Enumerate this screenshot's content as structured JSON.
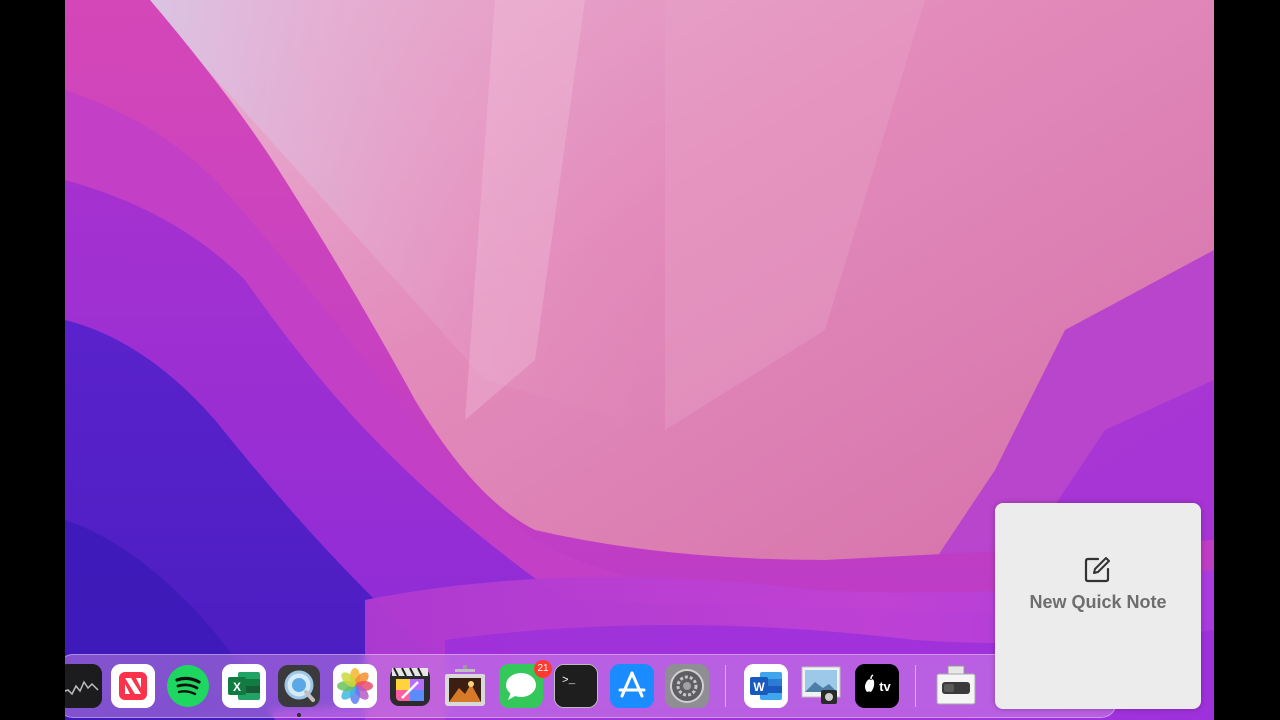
{
  "desktop": {
    "wallpaper": "macOS Monterey wallpaper",
    "accent_colors": [
      "#c955b0",
      "#8a2bd8",
      "#4b1fc4",
      "#e7a0c8"
    ]
  },
  "dock": {
    "apps": [
      {
        "name": "Stocks",
        "icon": "stocks-icon",
        "running": false
      },
      {
        "name": "News",
        "icon": "news-icon",
        "running": false
      },
      {
        "name": "Spotify",
        "icon": "spotify-icon",
        "running": false
      },
      {
        "name": "Microsoft Excel",
        "icon": "excel-icon",
        "running": false
      },
      {
        "name": "QuickTime Player",
        "icon": "quicktime-icon",
        "running": true
      },
      {
        "name": "Photos",
        "icon": "photos-icon",
        "running": false
      },
      {
        "name": "Final Cut Pro",
        "icon": "final-cut-pro-icon",
        "running": false
      },
      {
        "name": "Photo Slideshow",
        "icon": "slideshow-icon",
        "running": false
      },
      {
        "name": "Messages",
        "icon": "messages-icon",
        "running": false,
        "badge": "21"
      },
      {
        "name": "Terminal",
        "icon": "terminal-icon",
        "running": false
      },
      {
        "name": "App Store",
        "icon": "app-store-icon",
        "running": false
      },
      {
        "name": "System Preferences",
        "icon": "system-preferences-icon",
        "running": false
      },
      {
        "name": "Microsoft Word",
        "icon": "word-icon",
        "running": false
      },
      {
        "name": "Preview",
        "icon": "preview-icon",
        "running": false
      },
      {
        "name": "Apple TV",
        "icon": "apple-tv-icon",
        "running": false
      },
      {
        "name": "Downloads",
        "icon": "downloads-stack-icon",
        "running": false
      }
    ],
    "messages_badge": "21",
    "terminal_prompt": ">_"
  },
  "quick_note": {
    "label": "New Quick Note",
    "icon": "compose-icon"
  }
}
